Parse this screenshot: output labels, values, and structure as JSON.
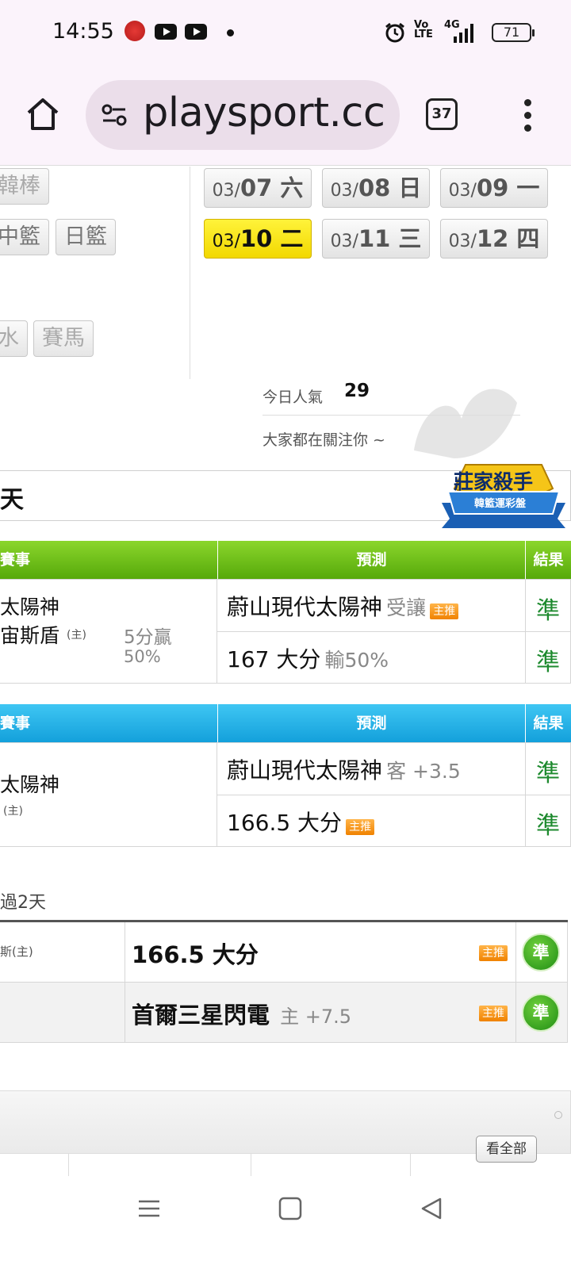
{
  "status": {
    "time": "14:55",
    "network": "4G",
    "volte": "Vo LTE",
    "battery": "71"
  },
  "browser": {
    "url": "playsport.cc",
    "tab_count": "37"
  },
  "sports": {
    "items": [
      "韓棒",
      "中籃",
      "日籃",
      "水",
      "賽馬"
    ]
  },
  "dates": [
    {
      "month": "03/",
      "day": "07 六"
    },
    {
      "month": "03/",
      "day": "08 日"
    },
    {
      "month": "03/",
      "day": "09 一"
    },
    {
      "month": "03/",
      "day": "10 二"
    },
    {
      "month": "03/",
      "day": "11 三"
    },
    {
      "month": "03/",
      "day": "12 四"
    }
  ],
  "popular": {
    "label": "今日人氣",
    "count": "29",
    "subtitle": "大家都在關注你 ~"
  },
  "day_header": {
    "label": "天",
    "badge_main": "莊家殺手",
    "badge_sub": "韓籃運彩盤"
  },
  "table1": {
    "headers": {
      "game": "賽事",
      "prediction": "預測",
      "result": "結果"
    },
    "game_lines": [
      "太陽神",
      "宙斯盾"
    ],
    "home_tag": "(主)",
    "score_note": "5分贏",
    "score_pct": "50%",
    "rows": [
      {
        "pick": "蔚山現代太陽神",
        "detail": "受讓",
        "tag": "主推",
        "result": "準"
      },
      {
        "pick": "167 大分",
        "detail": "輸50%",
        "tag": "",
        "result": "準"
      }
    ]
  },
  "table2": {
    "headers": {
      "game": "賽事",
      "prediction": "預測",
      "result": "結果"
    },
    "game_lines": [
      "太陽神"
    ],
    "home_tag": "(主)",
    "rows": [
      {
        "pick": "蔚山現代太陽神",
        "detail": "客 +3.5",
        "tag": "",
        "result": "準"
      },
      {
        "pick": "166.5 大分",
        "detail": "",
        "tag": "主推",
        "result": "準"
      }
    ]
  },
  "history": {
    "title": "過2天",
    "rows": [
      {
        "game": "斯(主)",
        "pick": "166.5 大分",
        "detail": "",
        "tag": "主推",
        "result": "準"
      },
      {
        "game": "",
        "pick": "首爾三星閃電",
        "detail": "主 +7.5",
        "tag": "主推",
        "result": "準"
      }
    ]
  },
  "panel": {
    "view_all": "看全部"
  }
}
